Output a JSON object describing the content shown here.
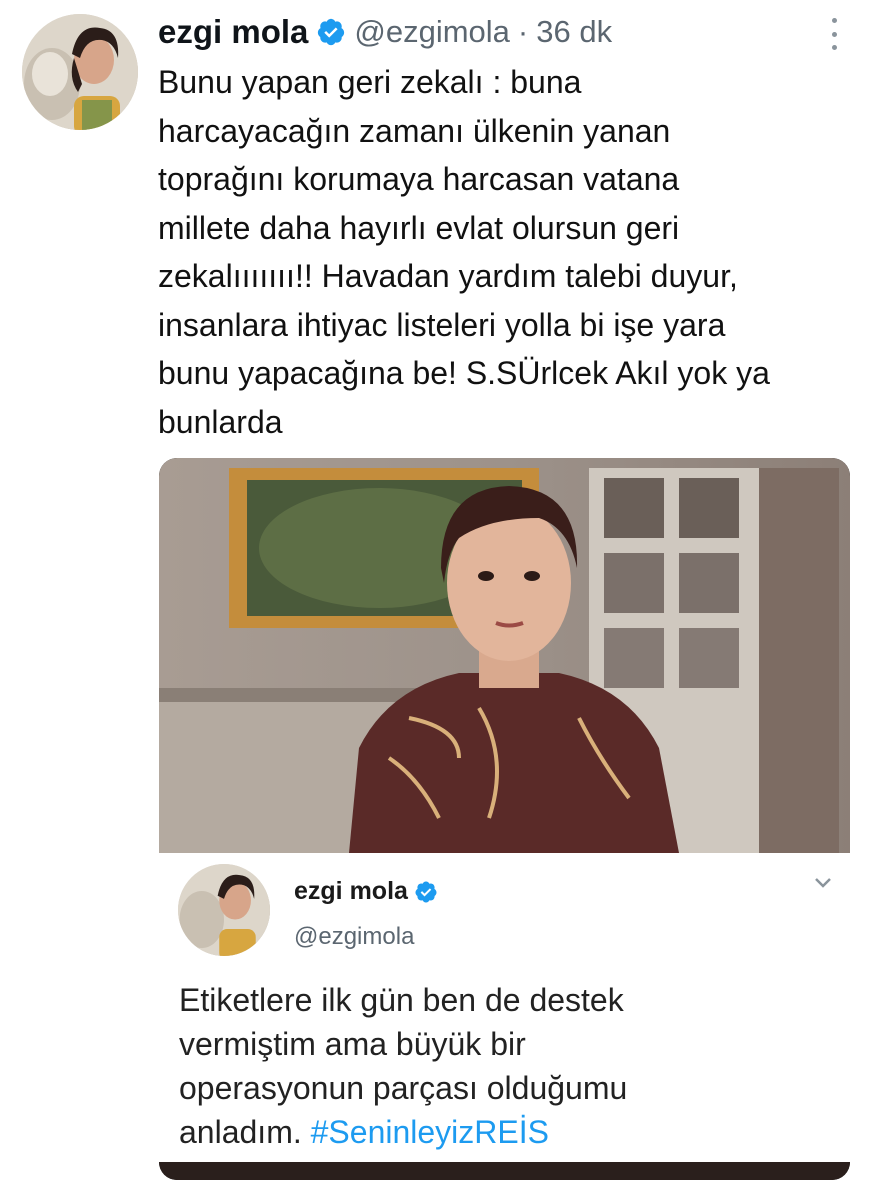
{
  "tweet": {
    "author_name": "ezgi mola",
    "author_handle": "@ezgimola",
    "separator": "·",
    "time": "36 dk",
    "text": "Bunu yapan geri zekalı : buna\nharcayacağın zamanı ülkenin yanan\ntoprağını korumaya harcasan vatana\nmillete daha hayırlı evlat olursun geri\nzekalııııııı!! Havadan yardım talebi duyur,\ninsanlara ihtiyac listeleri yolla bi işe yara\nbunu yapacağına be! S.SÜrlcek Akıl yok ya\nbunlarda"
  },
  "quoted": {
    "author_name": "ezgi mola",
    "author_handle": "@ezgimola",
    "text": "Etiketlere ilk gün ben de destek\nvermiştim ama büyük bir\noperasyonun parçası olduğumu\nanladım. ",
    "hashtag": "#SeninleyizREİS"
  },
  "colors": {
    "verified": "#1d9bf0",
    "hashtag": "#1d9bf0",
    "secondary_text": "#5b6670"
  },
  "icons": {
    "verified": "verified-badge-icon",
    "more": "more-vertical-icon",
    "chevron": "chevron-down-icon"
  }
}
